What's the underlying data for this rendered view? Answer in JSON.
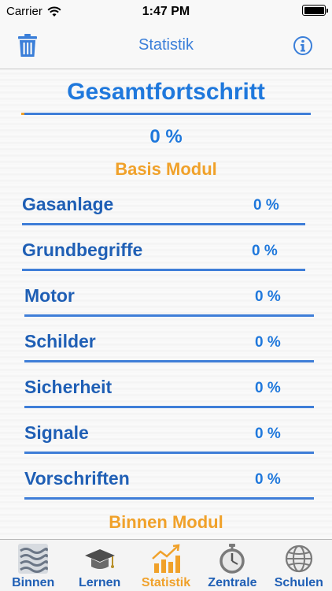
{
  "status_bar": {
    "carrier": "Carrier",
    "time": "1:47 PM"
  },
  "nav": {
    "title": "Statistik",
    "trash_icon": "trash-icon",
    "info_icon": "info-icon"
  },
  "overview": {
    "title": "Gesamtfortschritt",
    "value": "0 %",
    "progress": 0.01
  },
  "sections": [
    {
      "title": "Basis Modul",
      "items": [
        {
          "label": "Gasanlage",
          "value": "0 %"
        },
        {
          "label": "Grundbegriffe",
          "value": "0 %"
        },
        {
          "label": "Motor",
          "value": "0 %"
        },
        {
          "label": "Schilder",
          "value": "0 %"
        },
        {
          "label": "Sicherheit",
          "value": "0 %"
        },
        {
          "label": "Signale",
          "value": "0 %"
        },
        {
          "label": "Vorschriften",
          "value": "0 %"
        }
      ]
    },
    {
      "title": "Binnen Modul",
      "items": []
    }
  ],
  "tabs": [
    {
      "label": "Binnen",
      "icon": "waves-icon"
    },
    {
      "label": "Lernen",
      "icon": "graduation-cap-icon"
    },
    {
      "label": "Statistik",
      "icon": "chart-icon",
      "active": true
    },
    {
      "label": "Zentrale",
      "icon": "stopwatch-icon"
    },
    {
      "label": "Schulen",
      "icon": "globe-icon"
    }
  ],
  "colors": {
    "accent": "#1f78dc",
    "label": "#1f5fb5",
    "highlight": "#f0a12a",
    "divider": "#3f7ed8"
  }
}
